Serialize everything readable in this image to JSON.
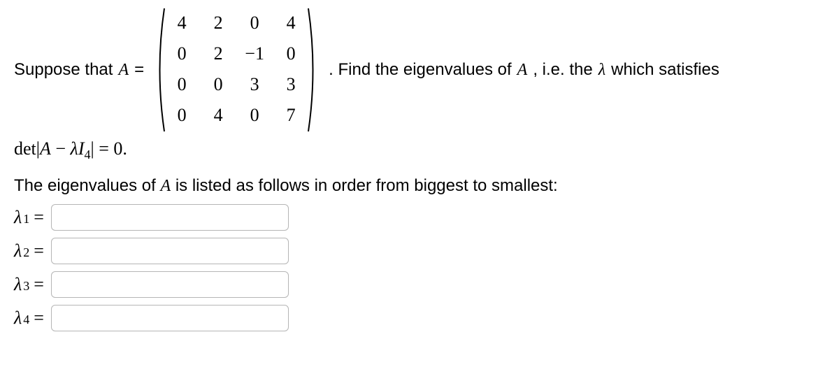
{
  "problem": {
    "prefix": "Suppose that ",
    "matrix_var": "A",
    "equals": " = ",
    "matrix": [
      [
        "4",
        "2",
        "0",
        "4"
      ],
      [
        "0",
        "2",
        "−1",
        "0"
      ],
      [
        "0",
        "0",
        "3",
        "3"
      ],
      [
        "0",
        "4",
        "0",
        "7"
      ]
    ],
    "suffix_1": ". Find the eigenvalues of ",
    "suffix_var": "A",
    "suffix_2": ", i.e. the ",
    "lambda_sym": "λ",
    "suffix_3": " which satisfies"
  },
  "det_line": {
    "det": "det",
    "bar1": "|",
    "A": "A",
    "minus": " − ",
    "lambda": "λ",
    "I": "I",
    "sub4": "4",
    "bar2": "|",
    "eq0": " = 0."
  },
  "instruction": {
    "text_1": "The eigenvalues of ",
    "var": "A",
    "text_2": " is listed as follows in order from biggest to smallest:"
  },
  "answers": [
    {
      "label": "λ",
      "sub": "1",
      "eq": "=",
      "value": ""
    },
    {
      "label": "λ",
      "sub": "2",
      "eq": "=",
      "value": ""
    },
    {
      "label": "λ",
      "sub": "3",
      "eq": "=",
      "value": ""
    },
    {
      "label": "λ",
      "sub": "4",
      "eq": "=",
      "value": ""
    }
  ]
}
